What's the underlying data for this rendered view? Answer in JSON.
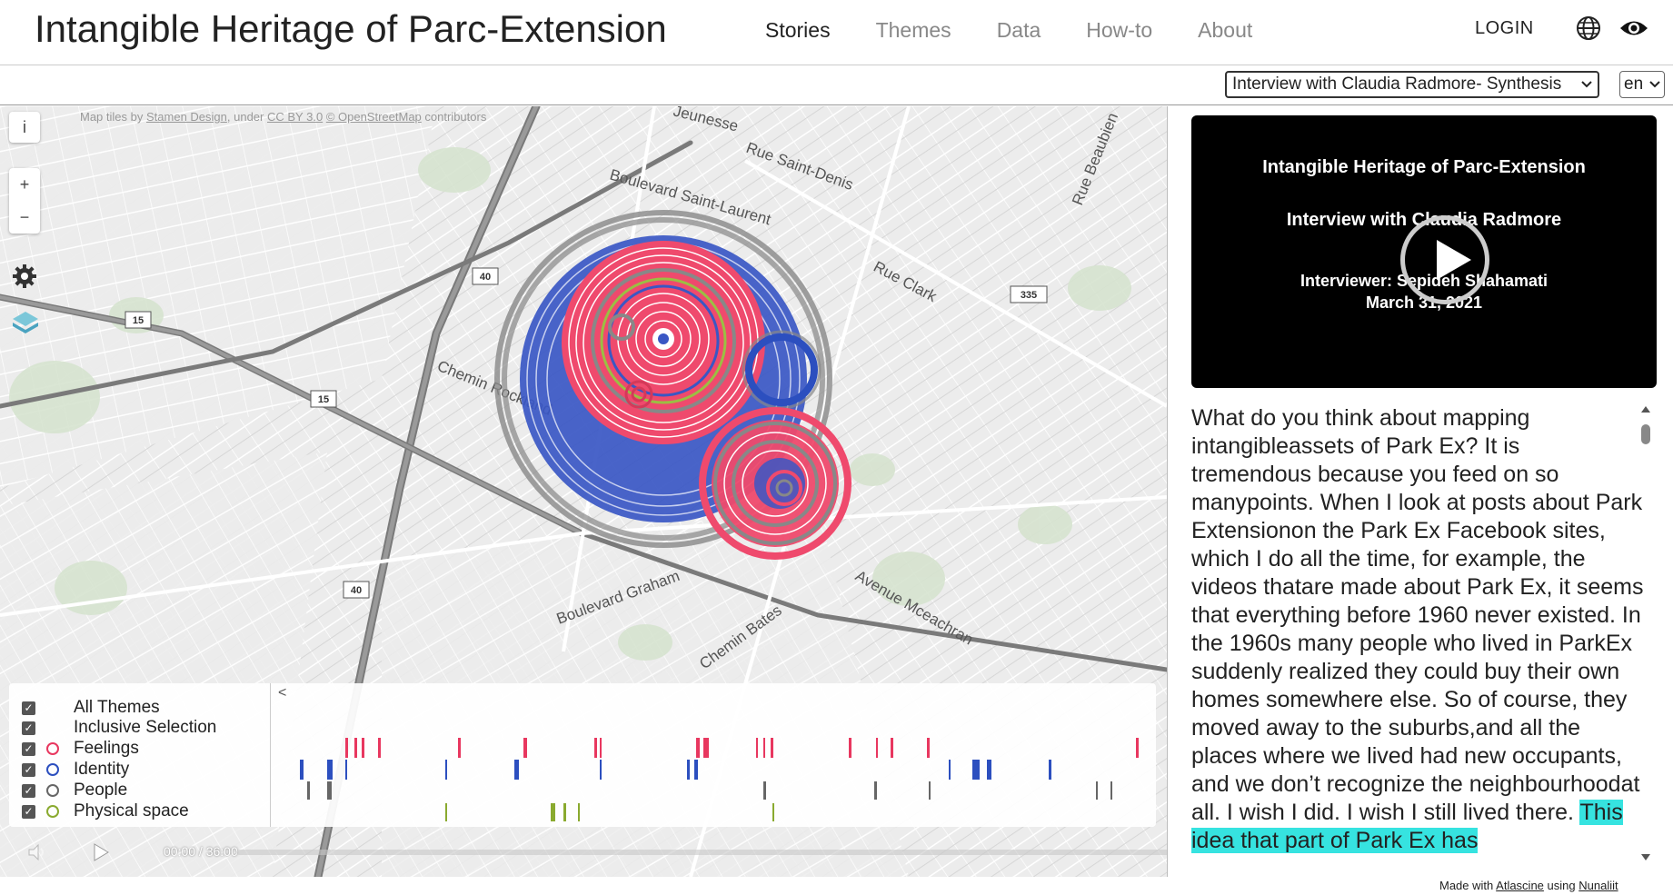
{
  "header": {
    "title": "Intangible Heritage of Parc-Extension",
    "nav": [
      "Stories",
      "Themes",
      "Data",
      "How-to",
      "About"
    ],
    "active_nav": "Stories",
    "login": "LOGIN"
  },
  "subbar": {
    "story_select": "Interview with Claudia Radmore- Synthesis",
    "lang_select": "en"
  },
  "map": {
    "attribution_prefix": "Map tiles by",
    "attribution_stamen": "Stamen Design",
    "attribution_mid": ", under",
    "attribution_cc": "CC BY 3.0",
    "attribution_osm": "© OpenStreetMap",
    "attribution_suffix": "contributors",
    "info_button": "i",
    "zoom_in": "+",
    "zoom_out": "−",
    "street_labels": [
      "Jeunesse",
      "Rue Saint-Denis",
      "Boulevard Saint-Laurent",
      "Rue Clark",
      "Chemin Rockland",
      "Boulevard Graham",
      "Avenue Mceachran",
      "Chemin Bates",
      "Rue Beaubien"
    ],
    "route_shields": [
      "40",
      "15",
      "15",
      "40",
      "335"
    ]
  },
  "legend": {
    "items": [
      {
        "label": "All Themes",
        "color": ""
      },
      {
        "label": "Inclusive Selection",
        "color": ""
      },
      {
        "label": "Feelings",
        "color": "#e8375f"
      },
      {
        "label": "Identity",
        "color": "#2c4fbf"
      },
      {
        "label": "People",
        "color": "#666666"
      },
      {
        "label": "Physical space",
        "color": "#8aaa2f"
      }
    ],
    "timeline_arrow": "<"
  },
  "player": {
    "time": "00:00 / 36:00"
  },
  "video": {
    "line1": "Intangible Heritage of Parc-Extension",
    "line2": "Interview with Claudia Radmore",
    "line3": "Interviewer: Sepideh Shahamati",
    "line4": "March 31, 2021"
  },
  "transcript": {
    "text": "What do you think about mapping intangibleassets of Park Ex? It is tremendous because you feed on so manypoints. When I look at posts about Park Extensionon the Park Ex Facebook sites, which I do all the time, for example, the videos thatare made about Park Ex, it seems that everything before 1960 never existed. In the 1960s many people who lived in ParkEx suddenly realized they could buy their own homes somewhere else. So of course, they moved away to the suburbs,and all the places where we lived had new occupants, and we don’t recognize the neighbourhoodat all. I wish I did. I wish I still lived there. ",
    "highlight": "This idea that part of Park Ex has"
  },
  "footer": {
    "prefix": "Made with",
    "atlascine": "Atlascine",
    "using": "using",
    "nunaliit": "Nunaliit"
  },
  "colors": {
    "feelings": "#e8375f",
    "identity": "#2c4fbf",
    "people": "#666666",
    "physical_space": "#8aaa2f",
    "highlight": "#36e3e0"
  }
}
